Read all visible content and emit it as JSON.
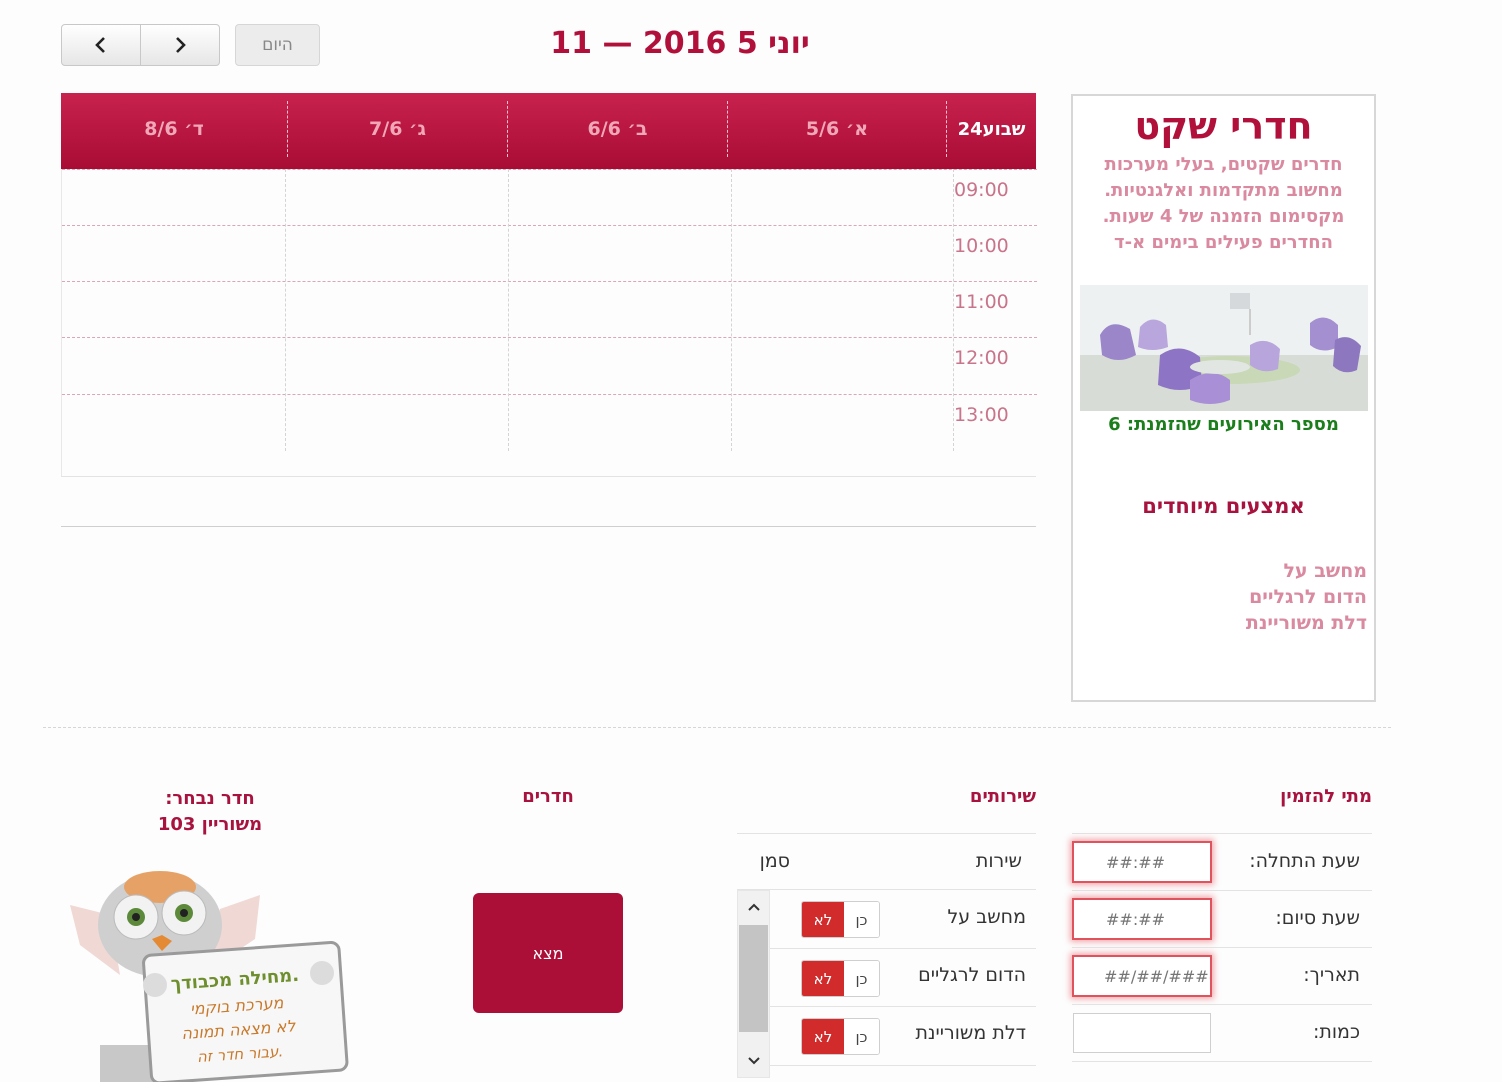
{
  "toolbar": {
    "prev_icon": "chevron-left-icon",
    "next_icon": "chevron-right-icon",
    "prev_glyph": "‹",
    "next_glyph": "›",
    "today_label": "היום",
    "title": "יוני 5 2016 — 11"
  },
  "calendar": {
    "week_label": "שבוע24",
    "days": [
      "ד׳ 8/6",
      "ג׳ 7/6",
      "ב׳ 6/6",
      "א׳ 5/6"
    ],
    "times": [
      "09:00",
      "10:00",
      "11:00",
      "12:00",
      "13:00"
    ]
  },
  "info": {
    "title": "חדרי שקט",
    "description": "חדרים שקטים, בעלי מערכות מחשוב מתקדמות ואלגנטיות. מקסימום הזמנה של 4 שעות. החדרים פעילים בימים א-ד",
    "events_count": "מספר האירועים שהזמנת: 6",
    "special_title": "אמצעים מיוחדים",
    "special_items": [
      "מחשב על",
      "הדום לרגליים",
      "דלת משוריינת"
    ]
  },
  "form": {
    "when_title": "מתי להזמין",
    "start_label": "שעת התחלה:",
    "start_placeholder": "##:##",
    "end_label": "שעת סיום:",
    "end_placeholder": "##:##",
    "date_label": "תאריך:",
    "date_placeholder": "##/##/####",
    "qty_label": "כמות:"
  },
  "services": {
    "title": "שירותים",
    "col_service": "שירות",
    "col_mark": "סמן",
    "yes_label": "כן",
    "no_label": "לא",
    "items": [
      "מחשב על",
      "הדום לרגליים",
      "דלת משוריינת"
    ]
  },
  "rooms": {
    "title": "חדרים",
    "find_label": "מצא"
  },
  "chosen": {
    "title": "חדר נבחר:",
    "room": "משוריין 103"
  },
  "owl_sign": {
    "line1": "מחילה מכבודך.",
    "line2": "מערכת בוקמי",
    "line3": "לא מצאה תמונה",
    "line4": "עבור חדר זה."
  },
  "colors": {
    "brand": "#b0103a",
    "button": "#ab0f38",
    "toggle_no": "#d12b2b",
    "count_green": "#1c7d1c"
  }
}
